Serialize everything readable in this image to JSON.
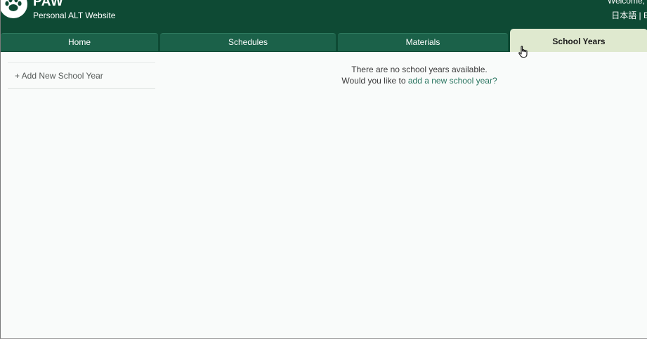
{
  "header": {
    "brand_name": "PAW",
    "brand_subtitle": "Personal ALT Website",
    "welcome_text": "Welcome, u",
    "language_switch": "日本語 | E",
    "logo_icon": "paw-icon"
  },
  "nav": {
    "tabs": [
      {
        "label": "Home",
        "active": false
      },
      {
        "label": "Schedules",
        "active": false
      },
      {
        "label": "Materials",
        "active": false
      },
      {
        "label": "School Years",
        "active": true
      }
    ]
  },
  "sidebar": {
    "add_label": "+ Add New School Year"
  },
  "main": {
    "empty_message": "There are no school years available.",
    "prompt_prefix": "Would you like to",
    "prompt_link": "add a new school year?"
  },
  "colors": {
    "header_bg": "#0e4a34",
    "tab_bg": "#1b6149",
    "active_tab_bg": "#dfe9cf",
    "link": "#2a7560",
    "page_bg": "#f9fbfa"
  }
}
